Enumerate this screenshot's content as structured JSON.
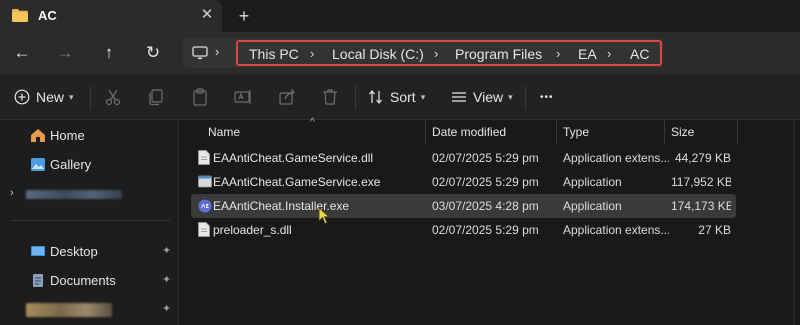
{
  "window": {
    "tab_title": "AC",
    "close_glyph": "✕",
    "new_tab_glyph": "+"
  },
  "nav": {
    "back_glyph": "←",
    "forward_glyph": "→",
    "up_glyph": "↑",
    "refresh_glyph": "↻",
    "separator_glyph": "›",
    "breadcrumbs": [
      "This PC",
      "Local Disk (C:)",
      "Program Files",
      "EA",
      "AC"
    ]
  },
  "toolbar": {
    "new_label": "New",
    "sort_label": "Sort",
    "view_label": "View",
    "more_glyph": "•••",
    "icons": [
      "cut-icon",
      "copy-icon",
      "paste-icon",
      "rename-icon",
      "share-icon",
      "delete-icon"
    ]
  },
  "sidebar": {
    "items": [
      {
        "label": "Home",
        "icon": "home-icon"
      },
      {
        "label": "Gallery",
        "icon": "gallery-icon"
      },
      {
        "label": "",
        "icon": "blurred-cloud-item"
      },
      {
        "label": "Desktop",
        "icon": "desktop-icon",
        "pinned": true
      },
      {
        "label": "Documents",
        "icon": "documents-icon",
        "pinned": true
      },
      {
        "label": "",
        "icon": "blurred-folder-item",
        "pinned": true
      }
    ],
    "pin_glyph": "📌"
  },
  "columns": {
    "name": "Name",
    "date": "Date modified",
    "type": "Type",
    "size": "Size"
  },
  "files": [
    {
      "name": "EAAntiCheat.GameService.dll",
      "date": "02/07/2025 5:29 pm",
      "type": "Application extens...",
      "size": "44,279 KB",
      "icon": "dll-icon"
    },
    {
      "name": "EAAntiCheat.GameService.exe",
      "date": "02/07/2025 5:29 pm",
      "type": "Application",
      "size": "117,952 KB",
      "icon": "exe-icon"
    },
    {
      "name": "EAAntiCheat.Installer.exe",
      "date": "03/07/2025 4:28 pm",
      "type": "Application",
      "size": "174,173 KB",
      "icon": "ea-installer-icon",
      "selected": true
    },
    {
      "name": "preloader_s.dll",
      "date": "02/07/2025 5:29 pm",
      "type": "Application extens...",
      "size": "27 KB",
      "icon": "dll-icon"
    }
  ],
  "colors": {
    "highlight_border": "#e0463f",
    "folder": "#e8b84a",
    "selection": "#3a3a3a",
    "cursor": "#e6d84a"
  }
}
